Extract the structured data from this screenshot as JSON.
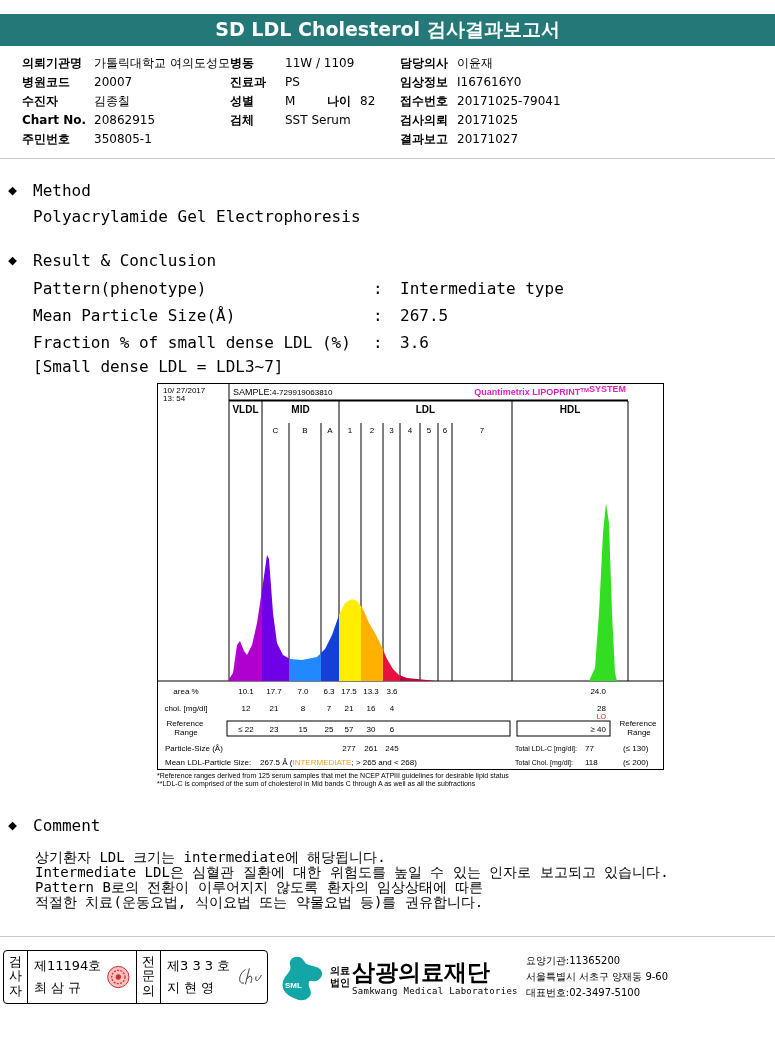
{
  "title": "SD LDL Cholesterol 검사결과보고서",
  "info_rows": [
    {
      "left": {
        "label": "의뢰기관명",
        "value": "가톨릭대학교 여의도성모"
      },
      "middle": [
        {
          "label": "병동",
          "value": "11W / 1109"
        }
      ],
      "right": {
        "label": "담당의사",
        "value": "이윤재"
      }
    },
    {
      "left": {
        "label": "병원코드",
        "value": "20007"
      },
      "middle": [
        {
          "label": "진료과",
          "value": "PS"
        }
      ],
      "right": {
        "label": "임상정보",
        "value": "I167616Y0"
      }
    },
    {
      "left": {
        "label": "수진자",
        "value": "김종칠"
      },
      "middle": [
        {
          "label": "성별",
          "value": "M"
        },
        {
          "label": "나이",
          "value": "82"
        }
      ],
      "right": {
        "label": "접수번호",
        "value": "20171025-79041"
      }
    },
    {
      "left": {
        "label": "Chart No.",
        "value": "20862915"
      },
      "middle": [
        {
          "label": "검체",
          "value": "SST Serum"
        }
      ],
      "right": {
        "label": "검사의뢰",
        "value": "20171025"
      }
    },
    {
      "left": {
        "label": "주민번호",
        "value": "350805-1"
      },
      "middle": [],
      "right": {
        "label": "결과보고",
        "value": "20171027"
      }
    }
  ],
  "method": {
    "bullet": "◆",
    "heading": "Method",
    "text": "Polyacrylamide Gel Electrophoresis"
  },
  "result": {
    "bullet": "◆",
    "heading": "Result & Conclusion",
    "rows": [
      {
        "label": "Pattern(phenotype)",
        "separator": ":",
        "value": "Intermediate type"
      },
      {
        "label": "Mean Particle Size(Å)",
        "separator": ":",
        "value": "267.5"
      },
      {
        "label": "Fraction % of small dense LDL (%)",
        "separator": ":",
        "value": "3.6"
      }
    ],
    "note": "[Small dense LDL = LDL3~7]"
  },
  "electrophoresis": {
    "date": "10/ 27/2017",
    "time": "13: 54",
    "sample_label": "SAMPLE:",
    "sample": "4-729919063810",
    "brand": "Quantimetrix LIPOPRINT$^{TM}$SYSTEM",
    "bands": [
      {
        "label": "VLDL"
      },
      {
        "label": "MID",
        "subbands": [
          "C",
          "B",
          "A"
        ]
      },
      {
        "label": "LDL",
        "subbands": [
          "1",
          "2",
          "3",
          "4",
          "5",
          "6",
          "7"
        ]
      },
      {
        "label": "HDL"
      }
    ],
    "area": {
      "label": "area %",
      "values": [
        "10.1",
        "17.7",
        "7.0",
        "6.3",
        "17.5",
        "13.3",
        "3.6"
      ],
      "hdl": "24.0"
    },
    "chol": {
      "label": "chol. [mg/dl]",
      "values": [
        "12",
        "21",
        "8",
        "7",
        "21",
        "16",
        "4"
      ],
      "hdl": "28",
      "hdl_flag": "LO"
    },
    "reference": {
      "label": "Reference Range",
      "values": [
        "≤ 22",
        "23",
        "15",
        "25",
        "57",
        "30",
        "6"
      ],
      "hdl": "≥ 40",
      "right_label": "Reference Range"
    },
    "particle_size": {
      "label": "Particle-Size (Å)",
      "values": [
        "277",
        "261",
        "245"
      ]
    },
    "mean_size": {
      "label": "Mean LDL-Particle Size:",
      "value": "267.5 Å",
      "open": "(",
      "class_label": "INTERMEDIATE",
      "rest": "; > 265 and < 268)"
    },
    "totals": [
      {
        "label": "Total LDL-C [mg/dl]:",
        "value": "77",
        "range": "(≤ 130)"
      },
      {
        "label": "Total Chol. [mg/dl]:",
        "value": "118",
        "range": "(≤ 200)"
      }
    ],
    "footnotes": [
      "*Reference ranges derived from 125 serum samples that met the NCEP ATPIII guidelines for desirable lipid status",
      "**LDL-C is comprised of the sum of cholesterol in Mid bands C through A as well as all the subfractions"
    ]
  },
  "comment": {
    "bullet": "◆",
    "heading": "Comment",
    "lines": [
      "상기환자 LDL 크기는 intermediate에 해당됩니다.",
      "Intermediate LDL은 심혈관 질환에 대한 위험도를 높일 수 있는 인자로 보고되고 있습니다.",
      "Pattern B로의 전환이 이루어지지 않도록 환자의 임상상태에 따른",
      "적절한 치료(운동요법, 식이요법 또는 약물요법 등)를 권유합니다."
    ]
  },
  "signatures": [
    {
      "role": "검사자",
      "license": "제11194호",
      "name": "최 삼 규",
      "kind": "seal"
    },
    {
      "role": "전문의",
      "license": "제3 3 3 호",
      "name": "지 현 영",
      "kind": "signature"
    }
  ],
  "organization": {
    "logo_text": "SML",
    "corp_type": "의료법인",
    "name": "삼광의료재단",
    "english_name": "Samkwang Medical Laboratories",
    "details": [
      "요양기관:11365200",
      "서울특별시 서초구 양재동 9-60",
      "대표번호:02-3497-5100"
    ]
  }
}
